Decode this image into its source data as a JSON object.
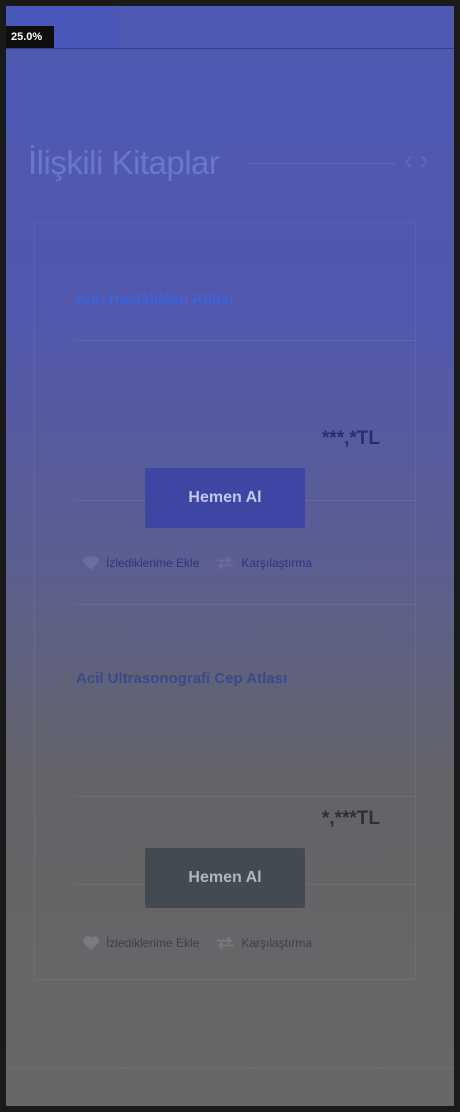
{
  "progress": {
    "label": "25.0%",
    "value": 25.0
  },
  "section": {
    "title": "İlişkili Kitaplar",
    "prev_arrow": "‹",
    "next_arrow": "›"
  },
  "books": [
    {
      "title": "Kan Hastalıkları Atlası",
      "price": "***,*TL",
      "buy_label": "Hemen Al",
      "watch_label": "İzlediklerime Ekle",
      "compare_label": "Karşılaştırma"
    },
    {
      "title": "Acil Ultrasonografi Cep Atlası",
      "price": "*,***TL",
      "buy_label": "Hemen Al",
      "watch_label": "İzlediklerime Ekle",
      "compare_label": "Karşılaştırma"
    }
  ],
  "icons": {
    "watch": "heart-icon",
    "compare": "compare-arrows-icon"
  },
  "colors": {
    "accent": "#3f63d8",
    "button_primary": "#3e45a3",
    "overlay": "#4e59b3"
  }
}
